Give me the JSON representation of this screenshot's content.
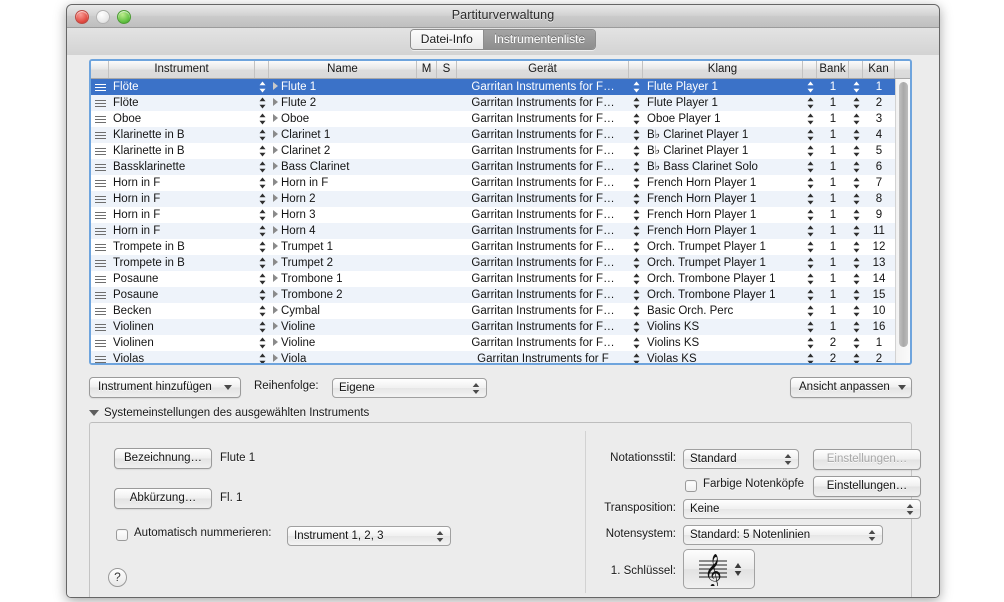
{
  "window": {
    "title": "Partiturverwaltung",
    "traffic_lights": [
      "close-button",
      "minimize-button",
      "zoom-button"
    ]
  },
  "tabs": [
    {
      "label": "Datei-Info",
      "active": false
    },
    {
      "label": "Instrumentenliste",
      "active": true
    }
  ],
  "table": {
    "columns": [
      {
        "key": "grip",
        "label": "",
        "width": 18
      },
      {
        "key": "instrument",
        "label": "Instrument",
        "width": 146
      },
      {
        "key": "step1",
        "label": "",
        "width": 14
      },
      {
        "key": "name",
        "label": "Name",
        "width": 148
      },
      {
        "key": "m",
        "label": "M",
        "width": 20
      },
      {
        "key": "s",
        "label": "S",
        "width": 20
      },
      {
        "key": "geraet",
        "label": "Gerät",
        "width": 172
      },
      {
        "key": "step2",
        "label": "",
        "width": 14
      },
      {
        "key": "klang",
        "label": "Klang",
        "width": 160
      },
      {
        "key": "step3",
        "label": "",
        "width": 14
      },
      {
        "key": "bank",
        "label": "Bank",
        "width": 32
      },
      {
        "key": "step4",
        "label": "",
        "width": 14
      },
      {
        "key": "kan",
        "label": "Kan",
        "width": 32
      },
      {
        "key": "del",
        "label": "",
        "width": 24
      }
    ],
    "rows": [
      {
        "instrument": "Flöte",
        "name": "Flute 1",
        "geraet": "Garritan Instruments for F…",
        "klang": "Flute Player 1",
        "bank": "1",
        "kan": "1",
        "selected": true
      },
      {
        "instrument": "Flöte",
        "name": "Flute 2",
        "geraet": "Garritan Instruments for F…",
        "klang": "Flute Player 1",
        "bank": "1",
        "kan": "2",
        "selected": false
      },
      {
        "instrument": "Oboe",
        "name": "Oboe",
        "geraet": "Garritan Instruments for F…",
        "klang": "Oboe Player 1",
        "bank": "1",
        "kan": "3",
        "selected": false
      },
      {
        "instrument": "Klarinette in B",
        "name": "Clarinet 1",
        "geraet": "Garritan Instruments for F…",
        "klang": "B♭ Clarinet Player 1",
        "bank": "1",
        "kan": "4",
        "selected": false
      },
      {
        "instrument": "Klarinette in B",
        "name": "Clarinet 2",
        "geraet": "Garritan Instruments for F…",
        "klang": "B♭ Clarinet Player 1",
        "bank": "1",
        "kan": "5",
        "selected": false
      },
      {
        "instrument": "Bassklarinette",
        "name": "Bass Clarinet",
        "geraet": "Garritan Instruments for F…",
        "klang": "B♭ Bass Clarinet Solo",
        "bank": "1",
        "kan": "6",
        "selected": false
      },
      {
        "instrument": "Horn in F",
        "name": "Horn in F",
        "geraet": "Garritan Instruments for F…",
        "klang": "French Horn Player 1",
        "bank": "1",
        "kan": "7",
        "selected": false
      },
      {
        "instrument": "Horn in F",
        "name": "Horn 2",
        "geraet": "Garritan Instruments for F…",
        "klang": "French Horn Player 1",
        "bank": "1",
        "kan": "8",
        "selected": false
      },
      {
        "instrument": "Horn in F",
        "name": "Horn 3",
        "geraet": "Garritan Instruments for F…",
        "klang": "French Horn Player 1",
        "bank": "1",
        "kan": "9",
        "selected": false
      },
      {
        "instrument": "Horn in F",
        "name": "Horn 4",
        "geraet": "Garritan Instruments for F…",
        "klang": "French Horn Player 1",
        "bank": "1",
        "kan": "11",
        "selected": false
      },
      {
        "instrument": "Trompete in B",
        "name": "Trumpet 1",
        "geraet": "Garritan Instruments for F…",
        "klang": "Orch. Trumpet Player 1",
        "bank": "1",
        "kan": "12",
        "selected": false
      },
      {
        "instrument": "Trompete in B",
        "name": "Trumpet 2",
        "geraet": "Garritan Instruments for F…",
        "klang": "Orch. Trumpet Player 1",
        "bank": "1",
        "kan": "13",
        "selected": false
      },
      {
        "instrument": "Posaune",
        "name": "Trombone 1",
        "geraet": "Garritan Instruments for F…",
        "klang": "Orch. Trombone Player 1",
        "bank": "1",
        "kan": "14",
        "selected": false
      },
      {
        "instrument": "Posaune",
        "name": "Trombone 2",
        "geraet": "Garritan Instruments for F…",
        "klang": "Orch. Trombone Player 1",
        "bank": "1",
        "kan": "15",
        "selected": false
      },
      {
        "instrument": "Becken",
        "name": "Cymbal",
        "geraet": "Garritan Instruments for F…",
        "klang": "Basic Orch. Perc",
        "bank": "1",
        "kan": "10",
        "selected": false
      },
      {
        "instrument": "Violinen",
        "name": "Violine",
        "geraet": "Garritan Instruments for F…",
        "klang": "Violins KS",
        "bank": "1",
        "kan": "16",
        "selected": false
      },
      {
        "instrument": "Violinen",
        "name": "Violine",
        "geraet": "Garritan Instruments for F…",
        "klang": "Violins KS",
        "bank": "2",
        "kan": "1",
        "selected": false
      },
      {
        "instrument": "Violas",
        "name": "Viola",
        "geraet": "Garritan Instruments for F",
        "klang": "Violas KS",
        "bank": "2",
        "kan": "2",
        "selected": false
      }
    ],
    "scrollbar": "vertical-scrollbar"
  },
  "toolbar": {
    "add_instrument_label": "Instrument hinzufügen",
    "order_label": "Reihenfolge:",
    "order_value": "Eigene",
    "adjust_view_label": "Ansicht anpassen"
  },
  "disclosure": {
    "label": "Systemeinstellungen des ausgewählten Instruments"
  },
  "settings_left": {
    "name_button": "Bezeichnung…",
    "name_value": "Flute 1",
    "abbrev_button": "Abkürzung…",
    "abbrev_value": "Fl. 1",
    "autonumber_label": "Automatisch nummerieren:",
    "autonumber_checked": false,
    "autonumber_value": "Instrument 1, 2, 3"
  },
  "settings_right": {
    "notation_style_label": "Notationsstil:",
    "notation_style_value": "Standard",
    "notation_settings_button": "Einstellungen…",
    "colored_noteheads_label": "Farbige Notenköpfe",
    "colored_noteheads_checked": false,
    "colored_settings_button": "Einstellungen…",
    "transposition_label": "Transposition:",
    "transposition_value": "Keine",
    "staff_label": "Notensystem:",
    "staff_value": "Standard: 5 Notenlinien",
    "clef_label": "1. Schlüssel:",
    "clef_glyph": "treble-clef-icon"
  },
  "help": {
    "label": "?"
  },
  "colors": {
    "selection_blue": "#3b72c8",
    "table_border": "#6ea4dd",
    "stripe": "#eef3fa",
    "window_bg": "#ececec"
  }
}
